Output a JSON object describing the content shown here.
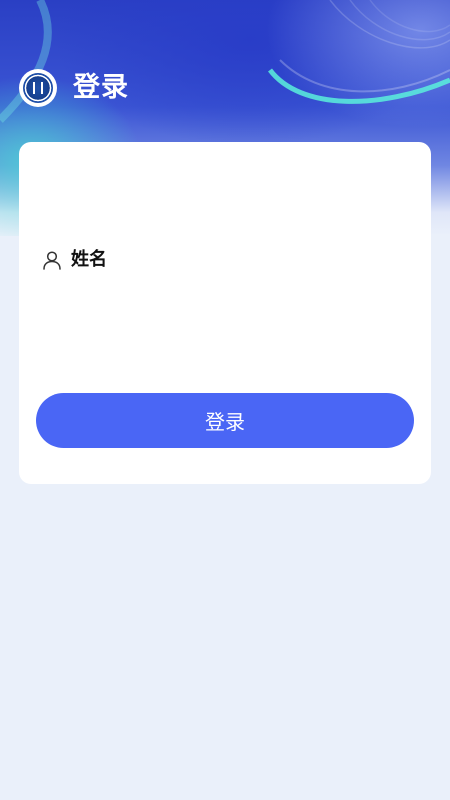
{
  "header": {
    "title": "登录",
    "logo_icon": "school-emblem-logo"
  },
  "form": {
    "name_label": "姓名",
    "name_value": "",
    "user_icon": "user-icon",
    "submit_label": "登录"
  },
  "colors": {
    "page_background": "#eaf0fa",
    "header_blue": "#2a3fc4",
    "accent_teal": "#46dcd2",
    "button_blue": "#4a66f5",
    "card_background": "#ffffff"
  }
}
